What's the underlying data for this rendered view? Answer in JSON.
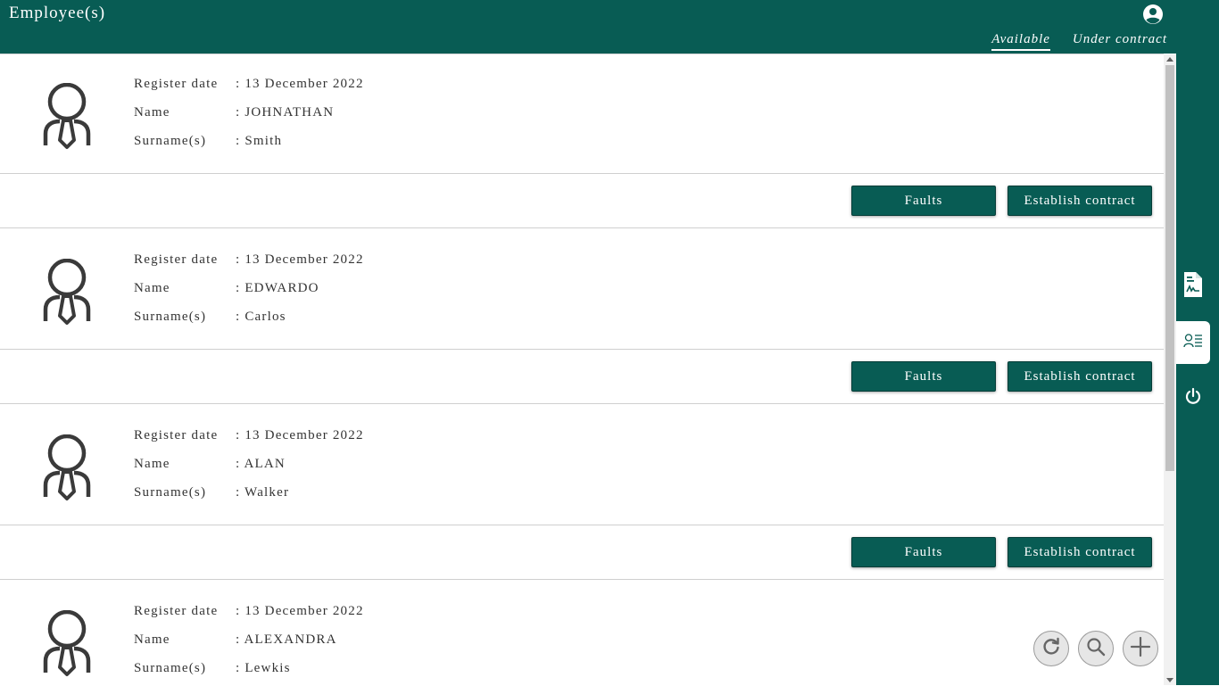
{
  "header": {
    "title": "Employee(s)",
    "account_icon": "account-circle-icon",
    "tabs": [
      {
        "label": "Available",
        "active": true
      },
      {
        "label": "Under contract",
        "active": false
      }
    ]
  },
  "sidebar": {
    "items": [
      {
        "icon": "contract-document-icon",
        "active": false
      },
      {
        "icon": "employee-list-icon",
        "active": true
      },
      {
        "icon": "power-icon",
        "active": false
      }
    ]
  },
  "labels": {
    "register_date": "Register date",
    "name": "Name",
    "surname": "Surname(s)",
    "faults_button": "Faults",
    "contract_button": "Establish contract"
  },
  "employees": [
    {
      "register_date": ": 13 December 2022",
      "name": ": JOHNATHAN",
      "surname": ": Smith"
    },
    {
      "register_date": ": 13 December 2022",
      "name": ": EDWARDO",
      "surname": ": Carlos"
    },
    {
      "register_date": ": 13 December 2022",
      "name": ": ALAN",
      "surname": ": Walker"
    },
    {
      "register_date": ": 13 December 2022",
      "name": ": ALEXANDRA",
      "surname": ": Lewkis"
    }
  ],
  "fabs": [
    {
      "icon": "refresh-icon"
    },
    {
      "icon": "search-icon"
    },
    {
      "icon": "add-icon"
    }
  ],
  "colors": {
    "brand": "#085c54",
    "text": "#333333",
    "divider": "#cfcfcf"
  }
}
